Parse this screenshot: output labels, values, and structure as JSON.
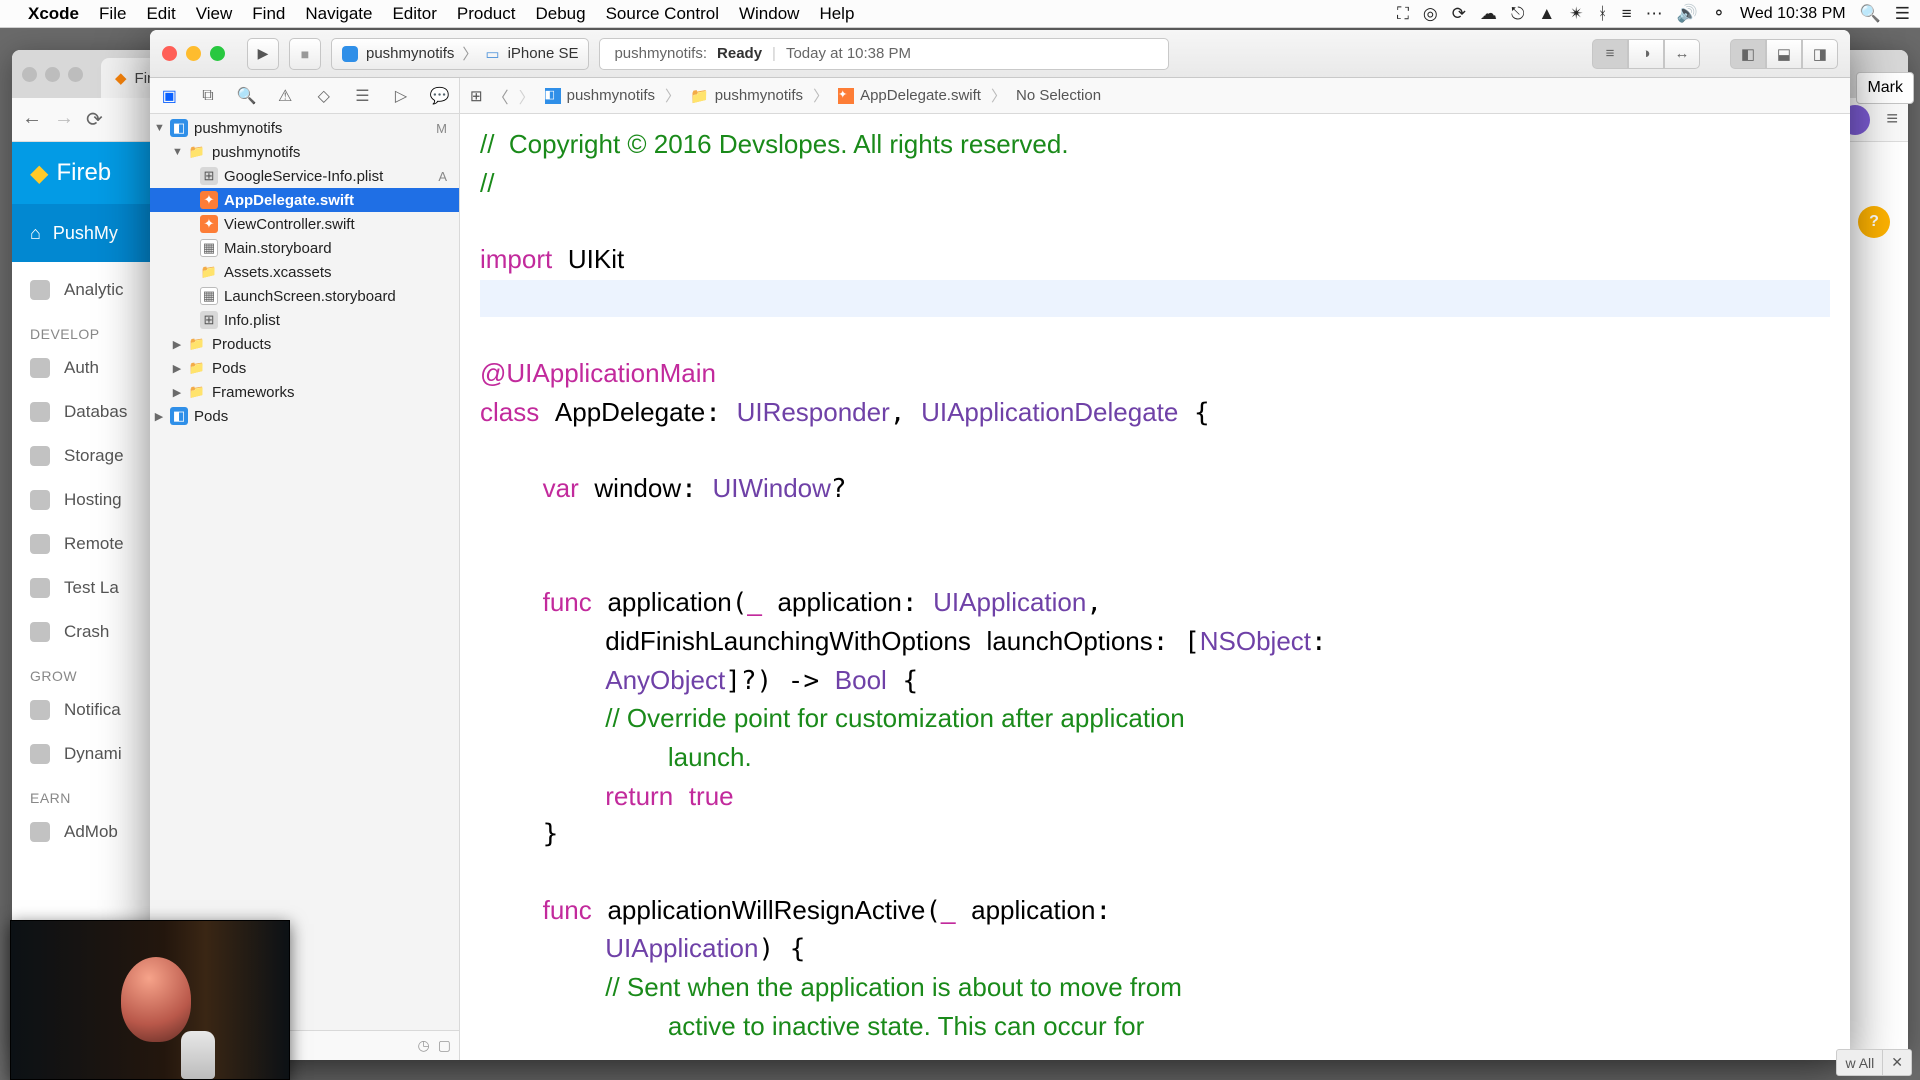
{
  "menubar": {
    "app": "Xcode",
    "items": [
      "File",
      "Edit",
      "View",
      "Find",
      "Navigate",
      "Editor",
      "Product",
      "Debug",
      "Source Control",
      "Window",
      "Help"
    ],
    "clock": "Wed 10:38 PM"
  },
  "chrome": {
    "tab": "Fireb",
    "mark_button": "Mark",
    "bottom_pill_all": "w All",
    "bottom_pill_x": "✕",
    "firebase": {
      "brand": "Fireb",
      "project": "PushMy",
      "nav": {
        "analytics": "Analytic",
        "header_develop": "DEVELOP",
        "auth": "Auth",
        "database": "Databas",
        "storage": "Storage",
        "hosting": "Hosting",
        "remote": "Remote",
        "testlab": "Test La",
        "crash": "Crash",
        "header_grow": "GROW",
        "notifications": "Notifica",
        "dynamic": "Dynami",
        "header_earn": "EARN",
        "admob": "AdMob"
      }
    }
  },
  "xcode": {
    "scheme_target": "pushmynotifs",
    "scheme_chevr": "〉",
    "scheme_device": "iPhone SE",
    "activity_project": "pushmynotifs:",
    "activity_status": "Ready",
    "activity_time_sep": "|",
    "activity_time": "Today at 10:38 PM",
    "jumpbar": {
      "project": "pushmynotifs",
      "group": "pushmynotifs",
      "file": "AppDelegate.swift",
      "selection": "No Selection"
    },
    "tree": {
      "root": "pushmynotifs",
      "root_status": "M",
      "group": "pushmynotifs",
      "files": [
        {
          "name": "GoogleService-Info.plist",
          "status": "A"
        },
        {
          "name": "AppDelegate.swift",
          "status": ""
        },
        {
          "name": "ViewController.swift",
          "status": ""
        },
        {
          "name": "Main.storyboard",
          "status": ""
        },
        {
          "name": "Assets.xcassets",
          "status": ""
        },
        {
          "name": "LaunchScreen.storyboard",
          "status": ""
        },
        {
          "name": "Info.plist",
          "status": ""
        }
      ],
      "products": "Products",
      "pods_group": "Pods",
      "frameworks": "Frameworks",
      "pods_proj": "Pods"
    },
    "code": {
      "c1": "//  Copyright © 2016 Devslopes. All rights reserved.",
      "c2": "//",
      "kw_import": "import",
      "uikit": "UIKit",
      "attr": "@UIApplicationMain",
      "kw_class": "class",
      "cls": "AppDelegate",
      "t_uiresponder": "UIResponder",
      "t_uiappdel": "UIApplicationDelegate",
      "kw_var": "var",
      "v_window": "window",
      "t_uiwindow": "UIWindow",
      "kw_func": "func",
      "f_app": "application",
      "p_app": "application",
      "t_uiapp": "UIApplication",
      "p_dfl": "didFinishLaunchingWithOptions",
      "p_lo": "launchOptions",
      "t_nsobj": "NSObject",
      "t_anyobj": "AnyObject",
      "t_bool": "Bool",
      "c_override": "// Override point for customization after application",
      "c_override2": "launch.",
      "kw_return": "return",
      "kw_true": "true",
      "f_resign": "applicationWillResignActive",
      "c_sent1": "// Sent when the application is about to move from",
      "c_sent2": "active to inactive state. This can occur for"
    }
  }
}
